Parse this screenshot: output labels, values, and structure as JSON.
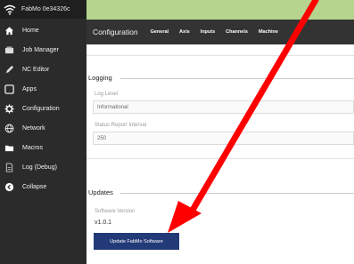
{
  "brand": {
    "title": "FabMo 0e34326c"
  },
  "sidebar": {
    "items": [
      {
        "label": "Home",
        "icon": "home-icon"
      },
      {
        "label": "Job Manager",
        "icon": "job-manager-icon"
      },
      {
        "label": "NC Editor",
        "icon": "nc-editor-icon"
      },
      {
        "label": "Apps",
        "icon": "apps-icon"
      },
      {
        "label": "Configuration",
        "icon": "gear-icon"
      },
      {
        "label": "Network",
        "icon": "globe-icon"
      },
      {
        "label": "Macros",
        "icon": "folder-icon"
      },
      {
        "label": "Log (Debug)",
        "icon": "log-icon"
      },
      {
        "label": "Collapse",
        "icon": "collapse-icon"
      }
    ]
  },
  "topbar": {
    "title": "Configuration",
    "tabs": [
      "General",
      "Axis",
      "Inputs",
      "Channels",
      "Machine"
    ],
    "active_tab": "General"
  },
  "logging": {
    "title": "Logging",
    "log_level_label": "Log Level",
    "log_level_value": "Informational",
    "status_interval_label": "Status Report Interval",
    "status_interval_value": "250"
  },
  "updates": {
    "title": "Updates",
    "software_version_label": "Software Version",
    "software_version_value": "v1.0.1",
    "update_button_label": "Update FabMo Software"
  },
  "colors": {
    "background": "#b7d48f",
    "sidebar": "#2b2b2b",
    "topbar": "#333333",
    "button": "#233a78",
    "arrow": "#ff0000"
  }
}
